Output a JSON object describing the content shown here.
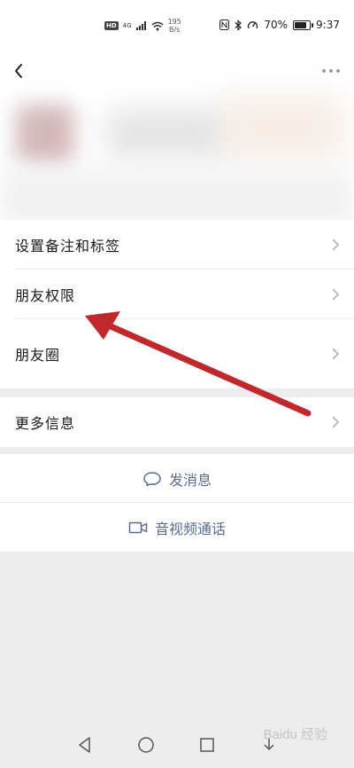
{
  "status_bar": {
    "hd": "HD",
    "signal": "4G",
    "net_speed_value": "195",
    "net_speed_unit": "B/s",
    "battery_percent": "70%",
    "battery_level": 0.7,
    "time": "9:37"
  },
  "header": {
    "back_icon": "chevron-left-icon",
    "more_icon": "more-dots-icon"
  },
  "menu": {
    "items": [
      {
        "label": "设置备注和标签"
      },
      {
        "label": "朋友权限"
      },
      {
        "label": "朋友圈"
      }
    ],
    "more_info": {
      "label": "更多信息"
    }
  },
  "actions": {
    "send_message": "发消息",
    "voice_video_call": "音视频通话"
  },
  "watermark": "Baidu 经验",
  "colors": {
    "link_blue": "#576b95",
    "annotation_red": "#c0282b",
    "background": "#ededed"
  }
}
